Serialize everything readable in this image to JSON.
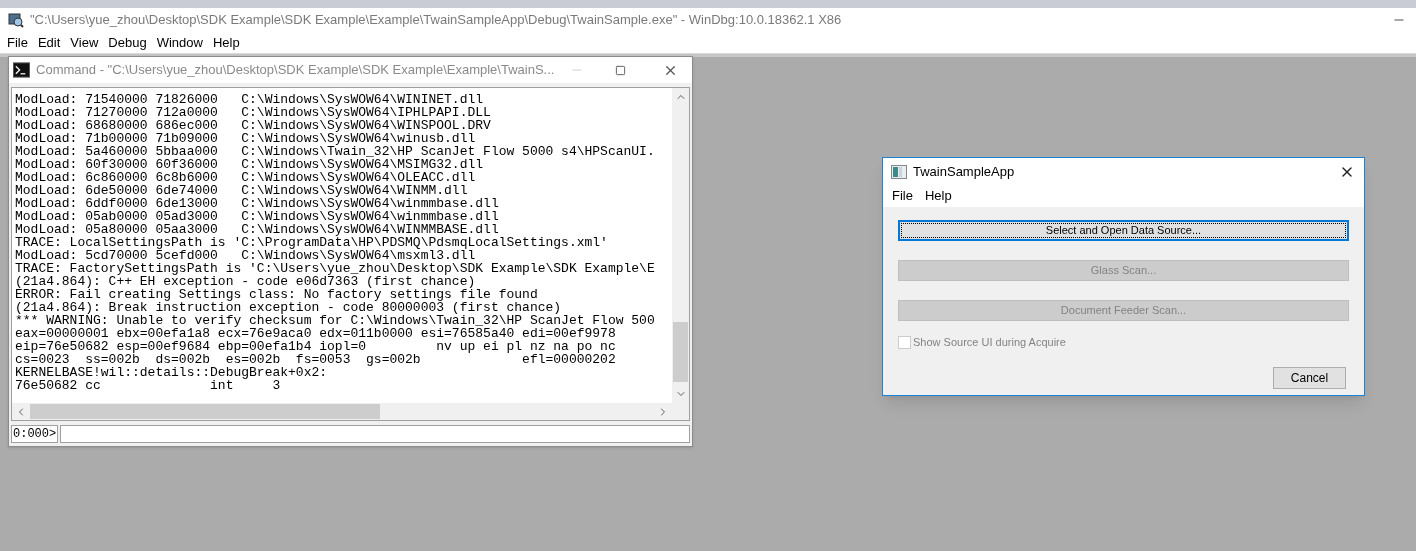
{
  "windbg": {
    "title": "\"C:\\Users\\yue_zhou\\Desktop\\SDK Example\\SDK Example\\Example\\TwainSampleApp\\Debug\\TwainSample.exe\" - WinDbg:10.0.18362.1 X86",
    "menu": [
      "File",
      "Edit",
      "View",
      "Debug",
      "Window",
      "Help"
    ]
  },
  "command_window": {
    "title": "Command - \"C:\\Users\\yue_zhou\\Desktop\\SDK Example\\SDK Example\\Example\\TwainS...",
    "lines": [
      "ModLoad: 71540000 71826000   C:\\Windows\\SysWOW64\\WININET.dll",
      "ModLoad: 71270000 712a0000   C:\\Windows\\SysWOW64\\IPHLPAPI.DLL",
      "ModLoad: 68680000 686ec000   C:\\Windows\\SysWOW64\\WINSPOOL.DRV",
      "ModLoad: 71b00000 71b09000   C:\\Windows\\SysWOW64\\winusb.dll",
      "ModLoad: 5a460000 5bbaa000   C:\\Windows\\Twain_32\\HP ScanJet Flow 5000 s4\\HPScanUI.",
      "ModLoad: 60f30000 60f36000   C:\\Windows\\SysWOW64\\MSIMG32.dll",
      "ModLoad: 6c860000 6c8b6000   C:\\Windows\\SysWOW64\\OLEACC.dll",
      "ModLoad: 6de50000 6de74000   C:\\Windows\\SysWOW64\\WINMM.dll",
      "ModLoad: 6ddf0000 6de13000   C:\\Windows\\SysWOW64\\winmmbase.dll",
      "ModLoad: 05ab0000 05ad3000   C:\\Windows\\SysWOW64\\winmmbase.dll",
      "ModLoad: 05a80000 05aa3000   C:\\Windows\\SysWOW64\\WINMMBASE.dll",
      "TRACE: LocalSettingsPath is 'C:\\ProgramData\\HP\\PDSMQ\\PdsmqLocalSettings.xml'",
      "ModLoad: 5cd70000 5cefd000   C:\\Windows\\SysWOW64\\msxml3.dll",
      "TRACE: FactorySettingsPath is 'C:\\Users\\yue_zhou\\Desktop\\SDK Example\\SDK Example\\E",
      "(21a4.864): C++ EH exception - code e06d7363 (first chance)",
      "ERROR: Fail creating Settings class: No factory settings file found",
      "(21a4.864): Break instruction exception - code 80000003 (first chance)",
      "*** WARNING: Unable to verify checksum for C:\\Windows\\Twain_32\\HP ScanJet Flow 500",
      "eax=00000001 ebx=00efa1a8 ecx=76e9aca0 edx=011b0000 esi=76585a40 edi=00ef9978",
      "eip=76e50682 esp=00ef9684 ebp=00efa1b4 iopl=0         nv up ei pl nz na po nc",
      "cs=0023  ss=002b  ds=002b  es=002b  fs=0053  gs=002b             efl=00000202",
      "KERNELBASE!wil::details::DebugBreak+0x2:",
      "76e50682 cc              int     3"
    ],
    "prompt": "0:000>"
  },
  "dialog": {
    "title": "TwainSampleApp",
    "menu": [
      "File",
      "Help"
    ],
    "buttons": [
      {
        "label": "Select and Open Data Source...",
        "disabled": false,
        "focused": true
      },
      {
        "label": "Glass Scan...",
        "disabled": true,
        "focused": false
      },
      {
        "label": "Document Feeder Scan...",
        "disabled": true,
        "focused": false
      }
    ],
    "checkbox": {
      "label": "Show Source UI during Acquire",
      "checked": false,
      "disabled": true
    },
    "cancel_button": {
      "label": "Cancel"
    }
  }
}
